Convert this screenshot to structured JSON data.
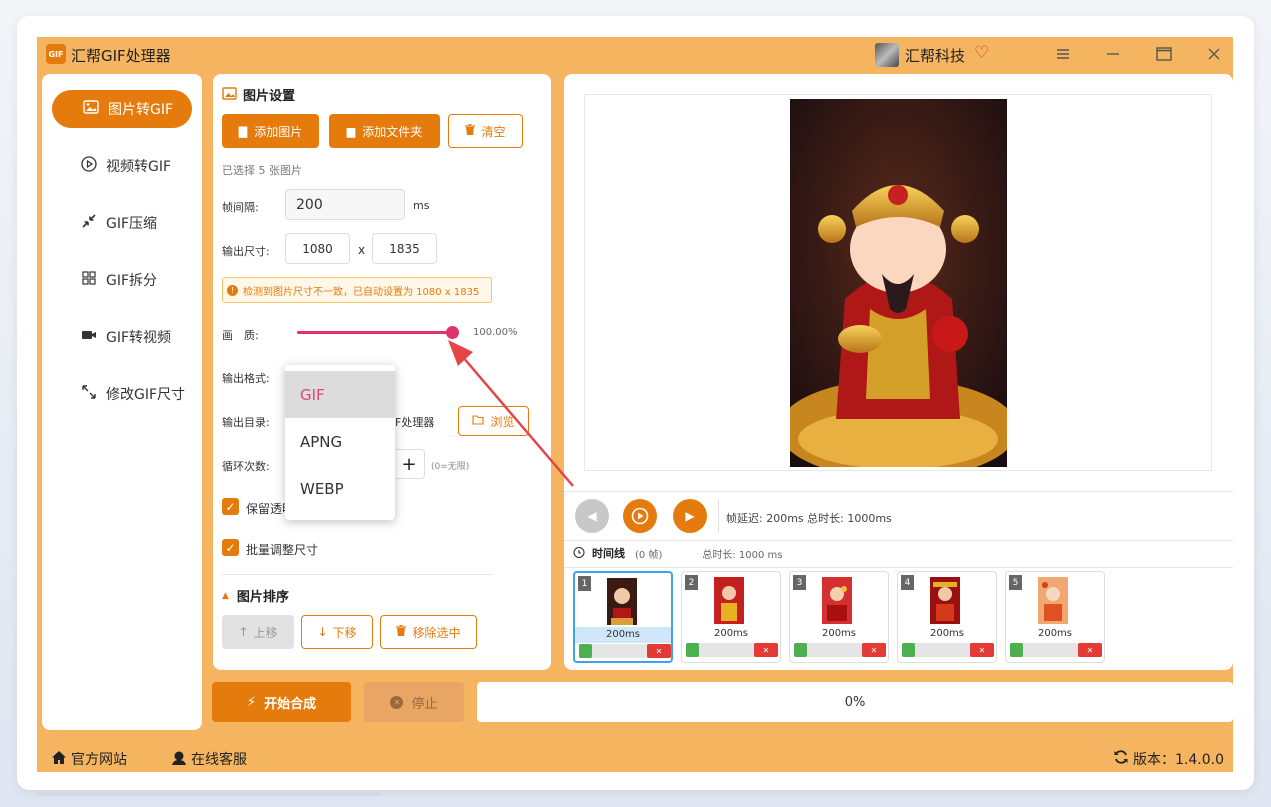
{
  "app": {
    "title": "汇帮GIF处理器",
    "logo_text": "GIF",
    "user": "汇帮科技",
    "window_controls": [
      "menu-icon",
      "minimize-icon",
      "maximize-icon",
      "close-icon"
    ]
  },
  "sidebar": {
    "items": [
      {
        "label": "图片转GIF",
        "icon": "image-icon",
        "active": true
      },
      {
        "label": "视频转GIF",
        "icon": "play-circle-icon",
        "active": false
      },
      {
        "label": "GIF压缩",
        "icon": "compress-icon",
        "active": false
      },
      {
        "label": "GIF拆分",
        "icon": "split-icon",
        "active": false
      },
      {
        "label": "GIF转视频",
        "icon": "video-icon",
        "active": false
      },
      {
        "label": "修改GIF尺寸",
        "icon": "resize-icon",
        "active": false
      }
    ]
  },
  "settings": {
    "title": "图片设置",
    "add_image": "添加图片",
    "add_folder": "添加文件夹",
    "clear": "清空",
    "selected_count": "已选择 5 张图片",
    "frame_interval_label": "帧间隔:",
    "frame_interval_value": "200",
    "frame_interval_unit": "ms",
    "output_size_label": "输出尺寸:",
    "width": "1080",
    "size_sep": "x",
    "height": "1835",
    "warning": "检测到图片尺寸不一致，已自动设置为 1080 x 1835",
    "quality_label": "画　质:",
    "quality_value": "100.00%",
    "quality_fraction": 1.0,
    "format_label": "输出格式:",
    "format_options": [
      "GIF",
      "APNG",
      "WEBP"
    ],
    "format_selected": "GIF",
    "output_dir_label": "输出目录:",
    "output_dir_value": "F处理器",
    "browse": "浏览",
    "loop_label": "循环次数:",
    "loop_hint": "(0=无限)",
    "keep_transparent_label": "保留透明",
    "keep_transparent_checked": true,
    "batch_resize_label": "批量调整尺寸",
    "batch_resize_checked": true,
    "sort_title": "图片排序",
    "move_up": "上移",
    "move_down": "下移",
    "remove_selected": "移除选中"
  },
  "preview": {
    "info": "帧延迟: 200ms  总时长: 1000ms",
    "timeline_label": "时间线",
    "timeline_frames": "(0 帧)",
    "timeline_total": "总时长: 1000 ms",
    "frames": [
      {
        "n": "1",
        "ms": "200ms",
        "active": true
      },
      {
        "n": "2",
        "ms": "200ms",
        "active": false
      },
      {
        "n": "3",
        "ms": "200ms",
        "active": false
      },
      {
        "n": "4",
        "ms": "200ms",
        "active": false
      },
      {
        "n": "5",
        "ms": "200ms",
        "active": false
      }
    ]
  },
  "actions": {
    "start": "开始合成",
    "stop": "停止",
    "progress": "0%",
    "progress_fraction": 0
  },
  "footer": {
    "website": "官方网站",
    "support": "在线客服",
    "version": "版本：1.4.0.0"
  },
  "colors": {
    "accent": "#e57b0d",
    "app_bg": "#f5b460",
    "slider": "#e0336b",
    "selected_text": "#e0457b"
  }
}
